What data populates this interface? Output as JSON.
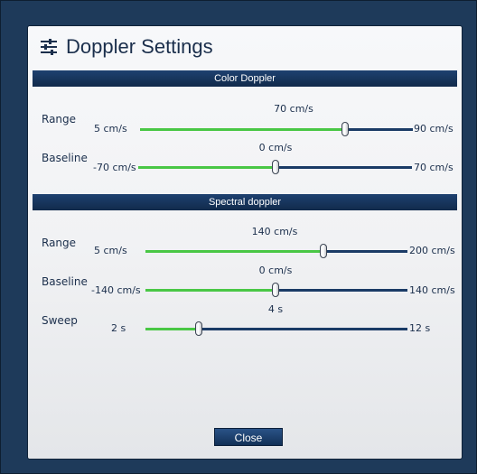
{
  "dialog": {
    "title": "Doppler Settings",
    "icon": "sliders-icon",
    "close_label": "Close"
  },
  "color_doppler": {
    "header": "Color Doppler",
    "range": {
      "label": "Range",
      "min_label": "5 cm/s",
      "max_label": "90 cm/s",
      "current_label": "70 cm/s",
      "min": 5,
      "max": 90,
      "value": 70
    },
    "baseline": {
      "label": "Baseline",
      "min_label": "-70 cm/s",
      "max_label": "70 cm/s",
      "current_label": "0 cm/s",
      "min": -70,
      "max": 70,
      "value": 0
    }
  },
  "spectral_doppler": {
    "header": "Spectral doppler",
    "range": {
      "label": "Range",
      "min_label": "5 cm/s",
      "max_label": "200 cm/s",
      "current_label": "140 cm/s",
      "min": 5,
      "max": 200,
      "value": 140
    },
    "baseline": {
      "label": "Baseline",
      "min_label": "-140 cm/s",
      "max_label": "140 cm/s",
      "current_label": "0 cm/s",
      "min": -140,
      "max": 140,
      "value": 0
    },
    "sweep": {
      "label": "Sweep",
      "min_label": "2 s",
      "max_label": "12 s",
      "current_label": "4 s",
      "min": 2,
      "max": 12,
      "value": 4
    }
  },
  "colors": {
    "background": "#1b3553",
    "section_header": "#16335a",
    "track_filled": "#49c745",
    "track_empty": "#1a3b66",
    "button": "#1e4170"
  }
}
